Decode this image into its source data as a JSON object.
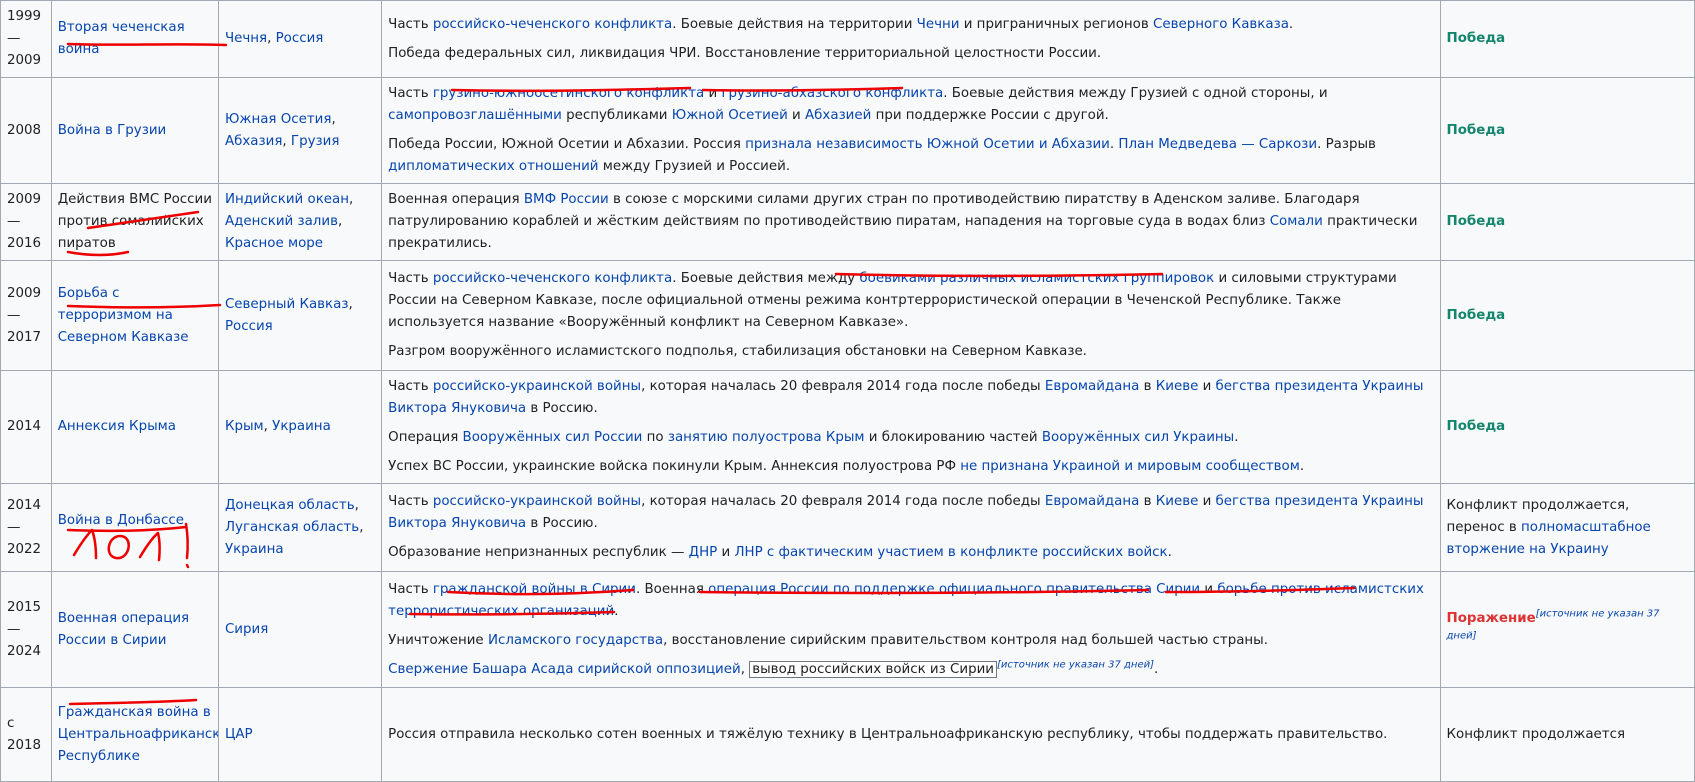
{
  "rows": [
    {
      "years": "1999—\n2009",
      "name": "Вторая чеченская война",
      "location": [
        "Чечня",
        ", ",
        "Россия"
      ],
      "desc1": [
        "Часть ",
        "российско-чеченского конфликта",
        ". Боевые действия на территории ",
        "Чечни",
        " и приграничных регионов ",
        "Северного Кавказа",
        "."
      ],
      "desc2": [
        "Победа федеральных сил, ликвидация ЧРИ. Восстановление территориальной целостности России."
      ],
      "result": "Победа"
    },
    {
      "years": "2008",
      "name": "Война в Грузии",
      "location": [
        "Южная Осетия",
        ",\n",
        "Абхазия",
        ", ",
        "Грузия"
      ],
      "desc1": [
        "Часть ",
        "грузино-южноосетинского конфликта",
        " и ",
        "грузино-абхазского конфликта",
        ". Боевые действия между Грузией с одной стороны, и ",
        "самопровозглашёнными",
        " республиками ",
        "Южной Осетией",
        " и ",
        "Абхазией",
        " при поддержке России с другой."
      ],
      "desc2": [
        "Победа России, Южной Осетии и Абхазии. Россия ",
        "признала независимость Южной Осетии и Абхазии",
        ". ",
        "План Медведева — Саркози",
        ". Разрыв ",
        "дипломатических отношений",
        " между Грузией и Россией."
      ],
      "result": "Победа"
    },
    {
      "years": "2009—\n2016",
      "name": "Действия ВМС России против сомалийских пиратов",
      "location": [
        "Индийский океан",
        ",\n",
        "Аденский залив",
        ",\n",
        "Красное море"
      ],
      "desc1": [
        "Военная операция ",
        "ВМФ России",
        " в союзе с морскими силами других стран по противодействию пиратству в Аденском заливе. Благодаря патрулированию кораблей и жёстким действиям по противодействию пиратам, нападения на торговые суда в водах близ ",
        "Сомали",
        " практически прекратились."
      ],
      "result": "Победа"
    },
    {
      "years": "2009—\n2017",
      "name": "Борьба с терроризмом на Северном Кавказе",
      "location": [
        "Северный Кавказ",
        ",\n",
        "Россия"
      ],
      "desc1": [
        "Часть ",
        "российско-чеченского конфликта",
        ". Боевые действия между ",
        "боевиками различных исламистских группировок",
        " и силовыми структурами России на Северном Кавказе, после официальной отмены режима контртеррористической операции в Чеченской Республике. Также используется название «Вооружённый конфликт на Северном Кавказе»."
      ],
      "desc2": [
        "Разгром вооружённого исламистского подполья, стабилизация обстановки на Северном Кавказе."
      ],
      "result": "Победа"
    },
    {
      "years": "2014",
      "name": "Аннексия Крыма",
      "location": [
        "Крым",
        ", ",
        "Украина"
      ],
      "desc1": [
        "Часть ",
        "российско-украинской войны",
        ", которая началась 20 февраля 2014 года после победы ",
        "Евромайдана",
        " в ",
        "Киеве",
        " и ",
        "бегства президента Украины Виктора Януковича",
        " в Россию."
      ],
      "desc2": [
        "Операция ",
        "Вооружённых сил России",
        " по ",
        "занятию полуострова Крым",
        " и блокированию частей ",
        "Вооружённых сил Украины",
        "."
      ],
      "desc3": [
        "Успех ВС России, украинские войска покинули Крым. Аннексия полуострова РФ ",
        "не признана Украиной и мировым сообществом",
        "."
      ],
      "result": "Победа"
    },
    {
      "years": "2014—\n2022",
      "name": "Война в Донбассе",
      "location": [
        "Донецкая область",
        ",\n",
        "Луганская область",
        ",\n",
        "Украина"
      ],
      "desc1": [
        "Часть ",
        "российско-украинской войны",
        ", которая началась 20 февраля 2014 года после победы ",
        "Евромайдана",
        " в ",
        "Киеве",
        " и ",
        "бегства президента Украины Виктора Януковича",
        " в Россию."
      ],
      "desc2": [
        "Образование непризнанных республик — ",
        "ДНР",
        " и ",
        "ЛНР с фактическим участием в конфликте российских войск",
        "."
      ],
      "result_plain": "Конфликт продолжается, перенос в ",
      "result_link": "полномасштабное вторжение на Украину"
    },
    {
      "years": "2015 —\n2024",
      "name": "Военная операция России в Сирии",
      "location": [
        "Сирия"
      ],
      "desc1": [
        "Часть ",
        "гражданской войны в Сирии",
        ". Военная ",
        "операция России по поддержке официального правительства Сирии",
        " и ",
        "борьбе против исламистских террористических организаций",
        "."
      ],
      "desc2": [
        "Уничтожение ",
        "Исламского государства",
        ", восстановление сирийским правительством контроля над большей частью страны."
      ],
      "desc3": [
        "Свержение Башара Асада сирийской оппозицией",
        ", ",
        "вывод российских войск из Сирии",
        "[",
        "источник не указан 37 дней",
        "]",
        "."
      ],
      "result": "Поражение",
      "result_cite": "[источник не указан 37 дней]"
    },
    {
      "years": "с 2018",
      "name": "Гражданская война в Центральноафриканской Республике",
      "location": [
        "ЦАР"
      ],
      "desc1": [
        "Россия отправила несколько сотен военных и тяжёлую технику в Центральноафриканскую республику, чтобы поддержать правительство."
      ],
      "result_plain": "Конфликт продолжается"
    }
  ],
  "annotation": {
    "handwritten_text": "лол!",
    "color": "#e00000"
  },
  "colors": {
    "link": "#0645ad",
    "victory": "#14866d",
    "defeat": "#dd3333",
    "cell_bg": "#f8f9fa",
    "border": "#a2a9b1"
  }
}
